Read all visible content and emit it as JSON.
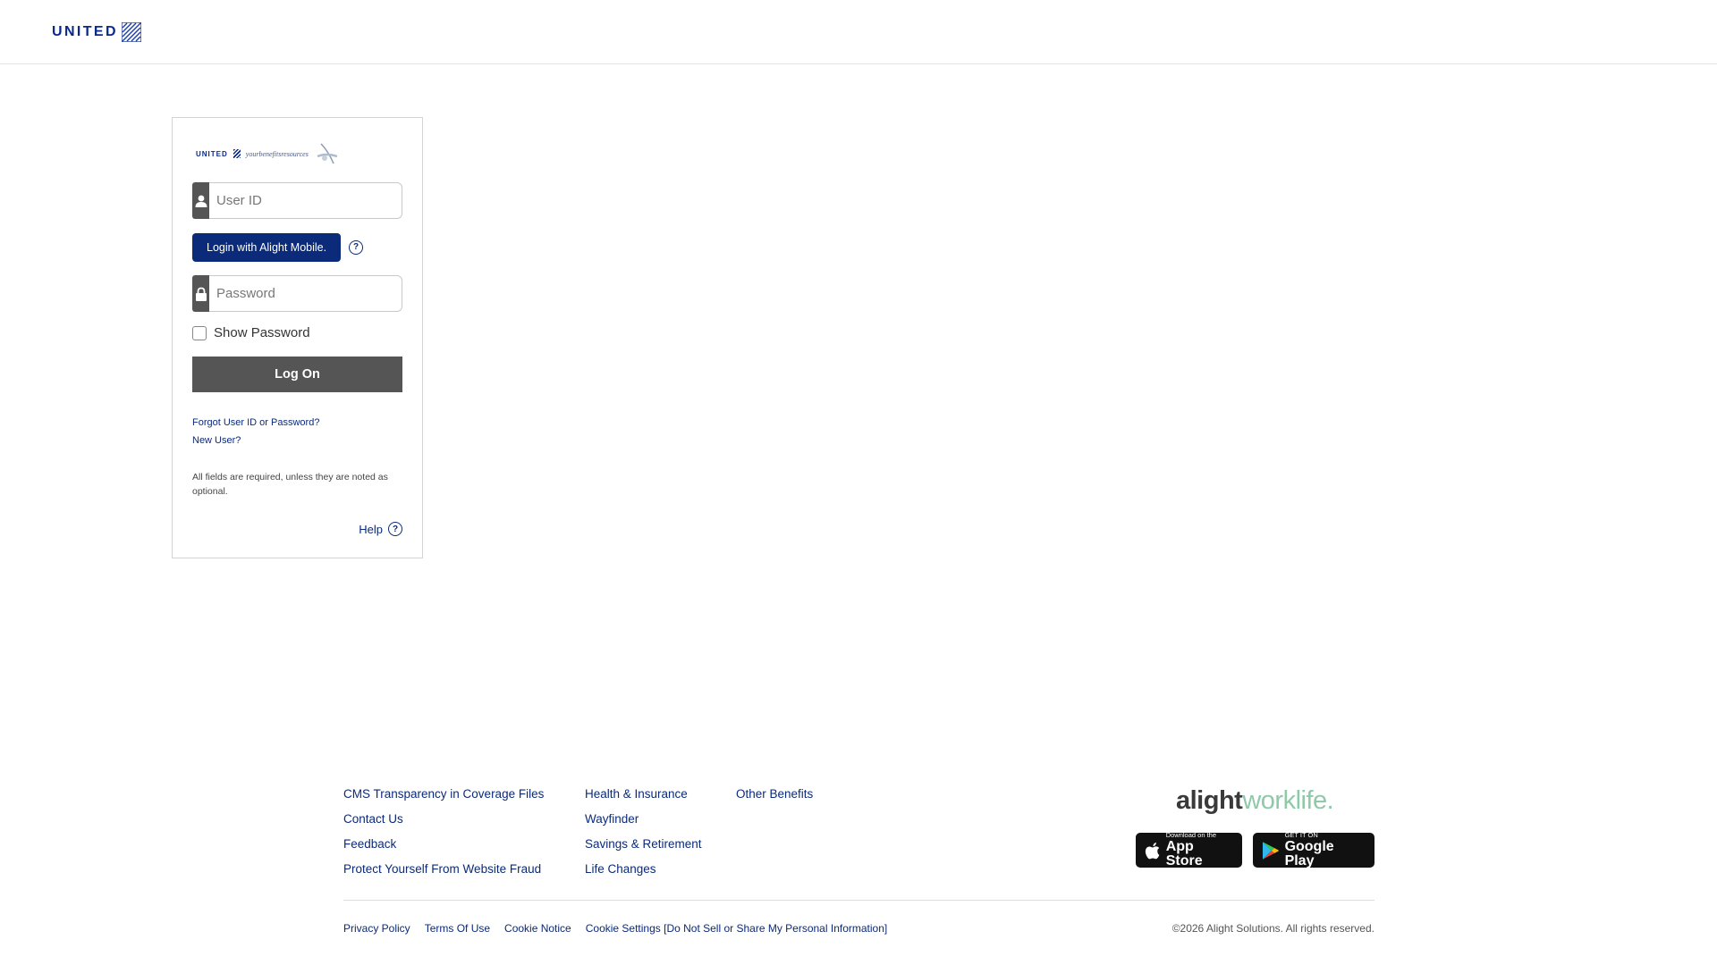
{
  "header": {
    "brand_text": "UNITED",
    "brand_icon": "united-globe-icon"
  },
  "login": {
    "logo_united": "UNITED",
    "logo_tagline": "yourbenefitsresources",
    "userid_placeholder": "User ID",
    "userid_icon": "user-icon",
    "mobile_button_label": "Login with Alight Mobile.",
    "mobile_help_icon": "question-circle-icon",
    "password_placeholder": "Password",
    "password_icon": "lock-icon",
    "show_password_label": "Show Password",
    "show_password_checked": false,
    "logon_label": "Log On",
    "forgot_link": "Forgot User ID or Password?",
    "new_user_link": "New User?",
    "required_note": "All fields are required, unless they are noted as optional.",
    "help_label": "Help",
    "help_icon": "question-circle-icon"
  },
  "footer": {
    "columns": [
      [
        "CMS Transparency in Coverage Files",
        "Contact Us",
        "Feedback",
        "Protect Yourself From Website Fraud"
      ],
      [
        "Health & Insurance",
        "Wayfinder",
        "Savings & Retirement",
        "Life Changes"
      ],
      [
        "Other Benefits"
      ]
    ],
    "logo_part1": "alight",
    "logo_part2": "worklife.",
    "app_store_small": "Download on the",
    "app_store_big": "App Store",
    "google_play_small": "GET IT ON",
    "google_play_big": "Google Play",
    "bottom_links": [
      "Privacy Policy",
      "Terms Of Use",
      "Cookie Notice",
      "Cookie Settings [Do Not Sell or Share My Personal Information]"
    ],
    "copyright": "©2026 Alight Solutions. All rights reserved."
  },
  "colors": {
    "brand_navy": "#0b2a7a",
    "button_gray": "#555555",
    "worklife_green": "#8fc9a8"
  }
}
